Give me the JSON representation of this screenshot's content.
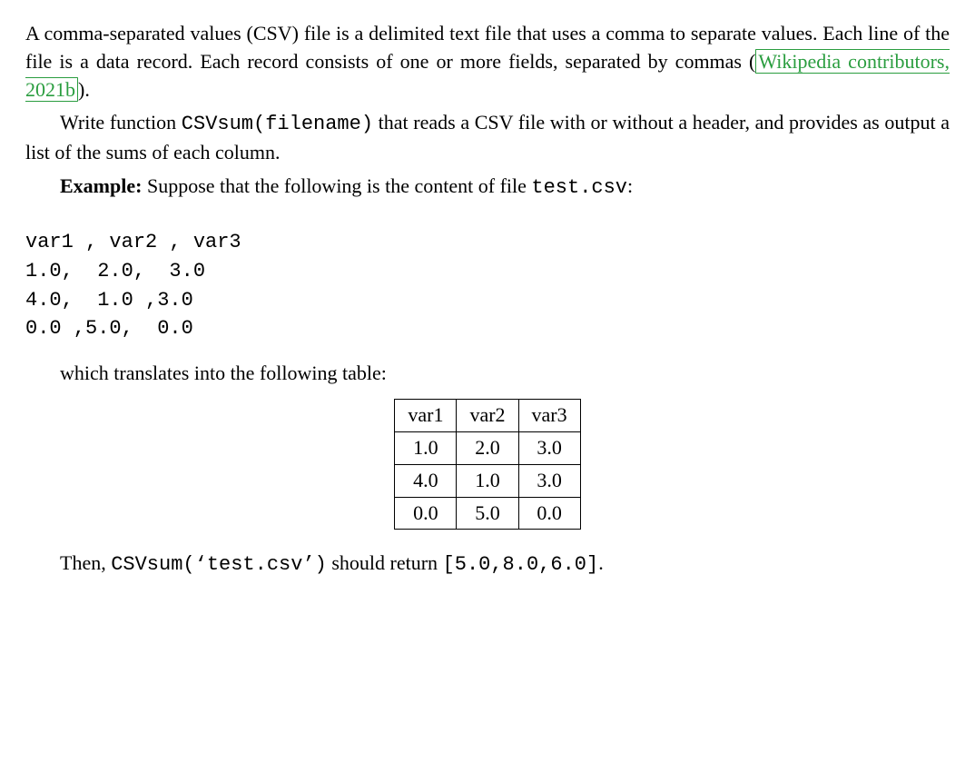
{
  "para1_a": "A comma-separated values (CSV) file is a delimited text file that uses a comma to separate values. Each line of the file is a data record. Each record consists of one or more fields, separated by commas (",
  "citation_text": "Wikipedia contributors, 2021b",
  "para1_b": ").",
  "para2_a": "Write function ",
  "para2_code": "CSVsum(filename)",
  "para2_b": " that reads a CSV file with or without a header, and provides as output a list of the sums of each column.",
  "example_label": "Example:",
  "example_text_a": " Suppose that the following is the content of file ",
  "example_file": "test.csv",
  "example_text_b": ":",
  "csv_raw": "var1 , var2 , var3\n1.0,  2.0,  3.0\n4.0,  1.0 ,3.0\n0.0 ,5.0,  0.0",
  "translate_text": "which translates into the following table:",
  "table": {
    "headers": [
      "var1",
      "var2",
      "var3"
    ],
    "rows": [
      [
        "1.0",
        "2.0",
        "3.0"
      ],
      [
        "4.0",
        "1.0",
        "3.0"
      ],
      [
        "0.0",
        "5.0",
        "0.0"
      ]
    ]
  },
  "chart_data": {
    "type": "table",
    "columns": [
      "var1",
      "var2",
      "var3"
    ],
    "rows": [
      [
        1.0,
        2.0,
        3.0
      ],
      [
        4.0,
        1.0,
        3.0
      ],
      [
        0.0,
        5.0,
        0.0
      ]
    ],
    "column_sums": [
      5.0,
      8.0,
      6.0
    ]
  },
  "then_a": "Then, ",
  "then_code": "CSVsum(‘test.csv’)",
  "then_b": " should return ",
  "then_result": "[5.0,8.0,6.0]",
  "then_c": "."
}
